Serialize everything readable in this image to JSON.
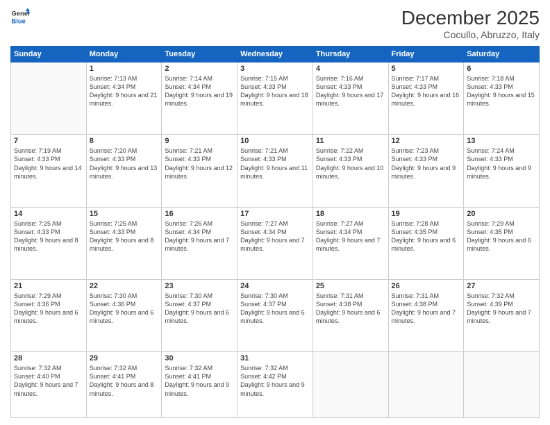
{
  "logo": {
    "line1": "General",
    "line2": "Blue"
  },
  "header": {
    "title": "December 2025",
    "subtitle": "Cocullo, Abruzzo, Italy"
  },
  "weekdays": [
    "Sunday",
    "Monday",
    "Tuesday",
    "Wednesday",
    "Thursday",
    "Friday",
    "Saturday"
  ],
  "weeks": [
    [
      {
        "day": "",
        "info": ""
      },
      {
        "day": "1",
        "info": "Sunrise: 7:13 AM\nSunset: 4:34 PM\nDaylight: 9 hours\nand 21 minutes."
      },
      {
        "day": "2",
        "info": "Sunrise: 7:14 AM\nSunset: 4:34 PM\nDaylight: 9 hours\nand 19 minutes."
      },
      {
        "day": "3",
        "info": "Sunrise: 7:15 AM\nSunset: 4:33 PM\nDaylight: 9 hours\nand 18 minutes."
      },
      {
        "day": "4",
        "info": "Sunrise: 7:16 AM\nSunset: 4:33 PM\nDaylight: 9 hours\nand 17 minutes."
      },
      {
        "day": "5",
        "info": "Sunrise: 7:17 AM\nSunset: 4:33 PM\nDaylight: 9 hours\nand 16 minutes."
      },
      {
        "day": "6",
        "info": "Sunrise: 7:18 AM\nSunset: 4:33 PM\nDaylight: 9 hours\nand 15 minutes."
      }
    ],
    [
      {
        "day": "7",
        "info": "Sunrise: 7:19 AM\nSunset: 4:33 PM\nDaylight: 9 hours\nand 14 minutes."
      },
      {
        "day": "8",
        "info": "Sunrise: 7:20 AM\nSunset: 4:33 PM\nDaylight: 9 hours\nand 13 minutes."
      },
      {
        "day": "9",
        "info": "Sunrise: 7:21 AM\nSunset: 4:33 PM\nDaylight: 9 hours\nand 12 minutes."
      },
      {
        "day": "10",
        "info": "Sunrise: 7:21 AM\nSunset: 4:33 PM\nDaylight: 9 hours\nand 11 minutes."
      },
      {
        "day": "11",
        "info": "Sunrise: 7:22 AM\nSunset: 4:33 PM\nDaylight: 9 hours\nand 10 minutes."
      },
      {
        "day": "12",
        "info": "Sunrise: 7:23 AM\nSunset: 4:33 PM\nDaylight: 9 hours\nand 9 minutes."
      },
      {
        "day": "13",
        "info": "Sunrise: 7:24 AM\nSunset: 4:33 PM\nDaylight: 9 hours\nand 9 minutes."
      }
    ],
    [
      {
        "day": "14",
        "info": "Sunrise: 7:25 AM\nSunset: 4:33 PM\nDaylight: 9 hours\nand 8 minutes."
      },
      {
        "day": "15",
        "info": "Sunrise: 7:25 AM\nSunset: 4:33 PM\nDaylight: 9 hours\nand 8 minutes."
      },
      {
        "day": "16",
        "info": "Sunrise: 7:26 AM\nSunset: 4:34 PM\nDaylight: 9 hours\nand 7 minutes."
      },
      {
        "day": "17",
        "info": "Sunrise: 7:27 AM\nSunset: 4:34 PM\nDaylight: 9 hours\nand 7 minutes."
      },
      {
        "day": "18",
        "info": "Sunrise: 7:27 AM\nSunset: 4:34 PM\nDaylight: 9 hours\nand 7 minutes."
      },
      {
        "day": "19",
        "info": "Sunrise: 7:28 AM\nSunset: 4:35 PM\nDaylight: 9 hours\nand 6 minutes."
      },
      {
        "day": "20",
        "info": "Sunrise: 7:29 AM\nSunset: 4:35 PM\nDaylight: 9 hours\nand 6 minutes."
      }
    ],
    [
      {
        "day": "21",
        "info": "Sunrise: 7:29 AM\nSunset: 4:36 PM\nDaylight: 9 hours\nand 6 minutes."
      },
      {
        "day": "22",
        "info": "Sunrise: 7:30 AM\nSunset: 4:36 PM\nDaylight: 9 hours\nand 6 minutes."
      },
      {
        "day": "23",
        "info": "Sunrise: 7:30 AM\nSunset: 4:37 PM\nDaylight: 9 hours\nand 6 minutes."
      },
      {
        "day": "24",
        "info": "Sunrise: 7:30 AM\nSunset: 4:37 PM\nDaylight: 9 hours\nand 6 minutes."
      },
      {
        "day": "25",
        "info": "Sunrise: 7:31 AM\nSunset: 4:38 PM\nDaylight: 9 hours\nand 6 minutes."
      },
      {
        "day": "26",
        "info": "Sunrise: 7:31 AM\nSunset: 4:38 PM\nDaylight: 9 hours\nand 7 minutes."
      },
      {
        "day": "27",
        "info": "Sunrise: 7:32 AM\nSunset: 4:39 PM\nDaylight: 9 hours\nand 7 minutes."
      }
    ],
    [
      {
        "day": "28",
        "info": "Sunrise: 7:32 AM\nSunset: 4:40 PM\nDaylight: 9 hours\nand 7 minutes."
      },
      {
        "day": "29",
        "info": "Sunrise: 7:32 AM\nSunset: 4:41 PM\nDaylight: 9 hours\nand 8 minutes."
      },
      {
        "day": "30",
        "info": "Sunrise: 7:32 AM\nSunset: 4:41 PM\nDaylight: 9 hours\nand 9 minutes."
      },
      {
        "day": "31",
        "info": "Sunrise: 7:32 AM\nSunset: 4:42 PM\nDaylight: 9 hours\nand 9 minutes."
      },
      {
        "day": "",
        "info": ""
      },
      {
        "day": "",
        "info": ""
      },
      {
        "day": "",
        "info": ""
      }
    ]
  ]
}
